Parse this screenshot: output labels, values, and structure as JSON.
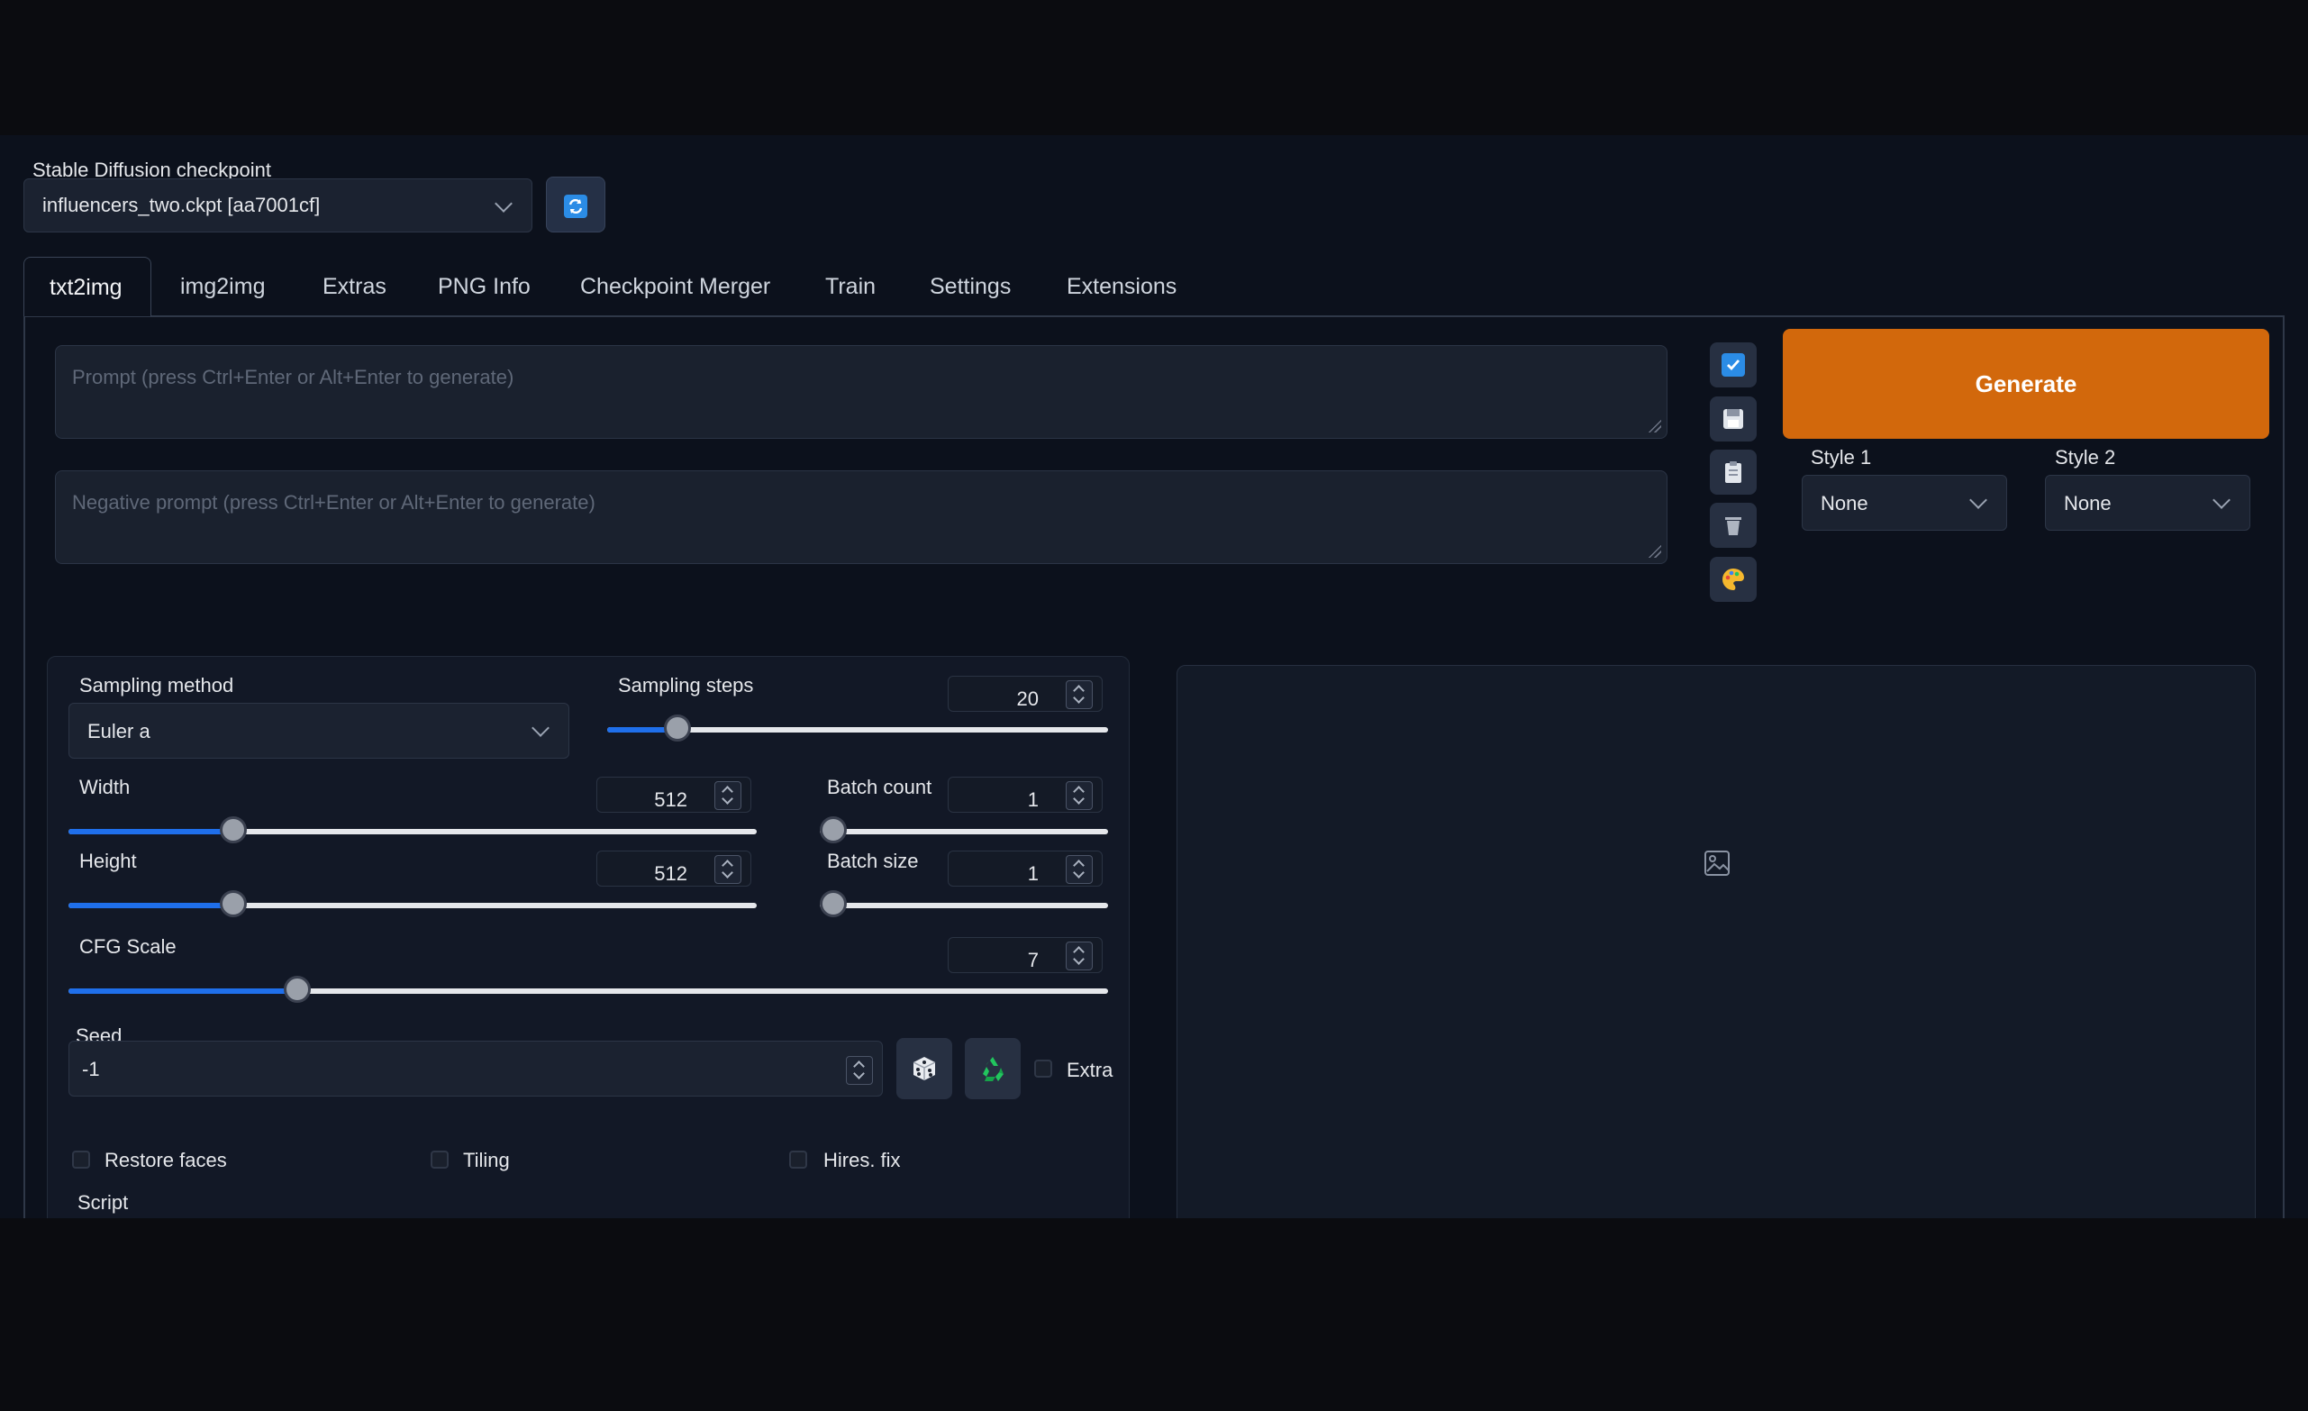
{
  "checkpoint": {
    "label": "Stable Diffusion checkpoint",
    "value": "influencers_two.ckpt [aa7001cf]"
  },
  "tabs": [
    {
      "label": "txt2img",
      "active": true
    },
    {
      "label": "img2img"
    },
    {
      "label": "Extras"
    },
    {
      "label": "PNG Info"
    },
    {
      "label": "Checkpoint Merger"
    },
    {
      "label": "Train"
    },
    {
      "label": "Settings"
    },
    {
      "label": "Extensions"
    }
  ],
  "prompt": {
    "placeholder": "Prompt (press Ctrl+Enter or Alt+Enter to generate)"
  },
  "negative_prompt": {
    "placeholder": "Negative prompt (press Ctrl+Enter or Alt+Enter to generate)"
  },
  "tools": [
    "checkbox-icon",
    "save-icon",
    "clipboard-icon",
    "trash-icon",
    "palette-icon"
  ],
  "generate": {
    "label": "Generate",
    "color": "#d2680c"
  },
  "styles": [
    {
      "label": "Style 1",
      "value": "None"
    },
    {
      "label": "Style 2",
      "value": "None"
    }
  ],
  "sampling_method": {
    "label": "Sampling method",
    "value": "Euler a"
  },
  "sampling_steps": {
    "label": "Sampling steps",
    "value": "20",
    "fraction": 0.14
  },
  "width": {
    "label": "Width",
    "value": "512",
    "fraction": 0.24
  },
  "height": {
    "label": "Height",
    "value": "512",
    "fraction": 0.24
  },
  "batch_count": {
    "label": "Batch count",
    "value": "1",
    "fraction": 0.0
  },
  "batch_size": {
    "label": "Batch size",
    "value": "1",
    "fraction": 0.0
  },
  "cfg_scale": {
    "label": "CFG Scale",
    "value": "7",
    "fraction": 0.22
  },
  "seed": {
    "label": "Seed",
    "value": "-1",
    "extra_label": "Extra"
  },
  "options": {
    "restore_faces": "Restore faces",
    "tiling": "Tiling",
    "hires_fix": "Hires. fix"
  },
  "script": {
    "label": "Script"
  },
  "accent_color": "#1f6feb"
}
